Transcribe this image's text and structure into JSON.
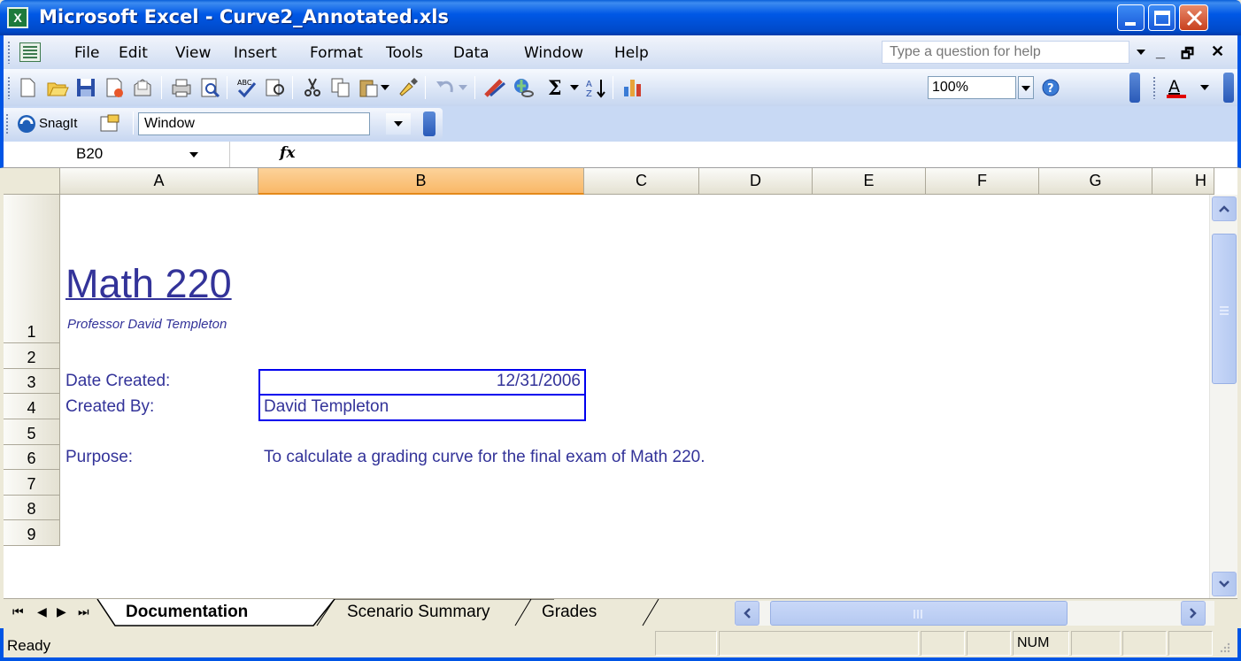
{
  "window": {
    "title": "Microsoft Excel - Curve2_Annotated.xls",
    "app_icon_letter": "X"
  },
  "menu": {
    "items": [
      "File",
      "Edit",
      "View",
      "Insert",
      "Format",
      "Tools",
      "Data",
      "Window",
      "Help"
    ],
    "help_placeholder": "Type a question for help"
  },
  "toolbar": {
    "zoom": "100%",
    "icons": [
      "new-icon",
      "open-icon",
      "save-icon",
      "permission-icon",
      "email-icon",
      "print-icon",
      "print-preview-icon",
      "spelling-icon",
      "research-icon",
      "cut-icon",
      "copy-icon",
      "paste-icon",
      "format-painter-icon",
      "undo-icon",
      "insert-hyperlink-icon",
      "drawing-icon",
      "autosum-icon",
      "sort-ascending-icon",
      "chart-wizard-icon",
      "help-icon",
      "font-color-icon"
    ]
  },
  "snagit": {
    "label": "SnagIt",
    "combo_value": "Window"
  },
  "formula_bar": {
    "name_box": "B20",
    "fx_label": "fx",
    "content": ""
  },
  "grid": {
    "columns": [
      "A",
      "B",
      "C",
      "D",
      "E",
      "F",
      "G",
      "H"
    ],
    "selected_column": "B",
    "rows": [
      "1",
      "2",
      "3",
      "4",
      "5",
      "6",
      "7",
      "8",
      "9"
    ],
    "title": "Math 220",
    "subtitle": "Professor David Templeton",
    "date_label": "Date Created:",
    "date_value": "12/31/2006",
    "author_label": "Created By:",
    "author_value": "David Templeton",
    "purpose_label": "Purpose:",
    "purpose_value": "To calculate a grading curve for the final exam of Math 220."
  },
  "sheets": {
    "tabs": [
      "Documentation",
      "Scenario Summary",
      "Grades"
    ],
    "active": "Documentation"
  },
  "status": {
    "text": "Ready",
    "num": "NUM"
  }
}
